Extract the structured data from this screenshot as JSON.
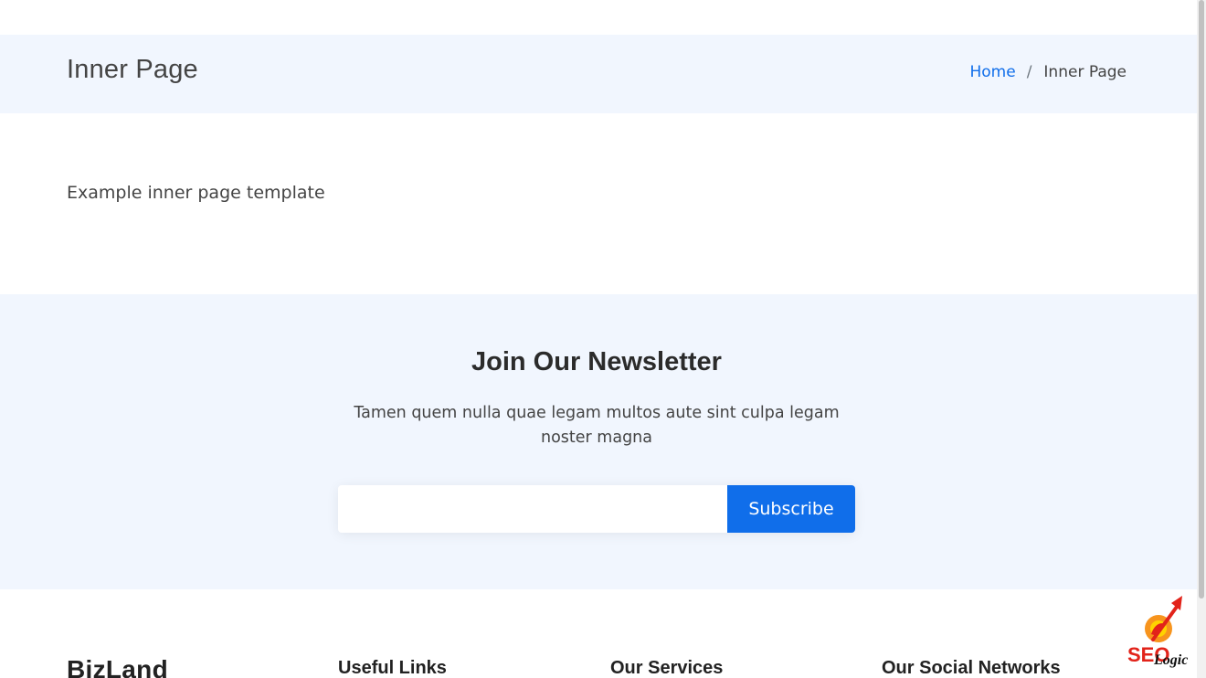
{
  "breadcrumbs": {
    "title": "Inner Page",
    "items": [
      {
        "label": "Home"
      },
      {
        "label": "Inner Page"
      }
    ],
    "separator": "/"
  },
  "content": {
    "text": "Example inner page template"
  },
  "newsletter": {
    "title": "Join Our Newsletter",
    "text": "Tamen quem nulla quae legam multos aute sint culpa legam noster magna",
    "email_value": "",
    "subscribe_label": "Subscribe"
  },
  "footer": {
    "brand": "BizLand",
    "headings": {
      "useful_links": "Useful Links",
      "services": "Our Services",
      "social": "Our Social Networks"
    }
  },
  "watermark": {
    "brand": "SEO",
    "subtitle": "Logic"
  },
  "colors": {
    "accent": "#106eea",
    "section_bg": "#f1f6fe",
    "text": "#444444",
    "heading": "#222222"
  }
}
